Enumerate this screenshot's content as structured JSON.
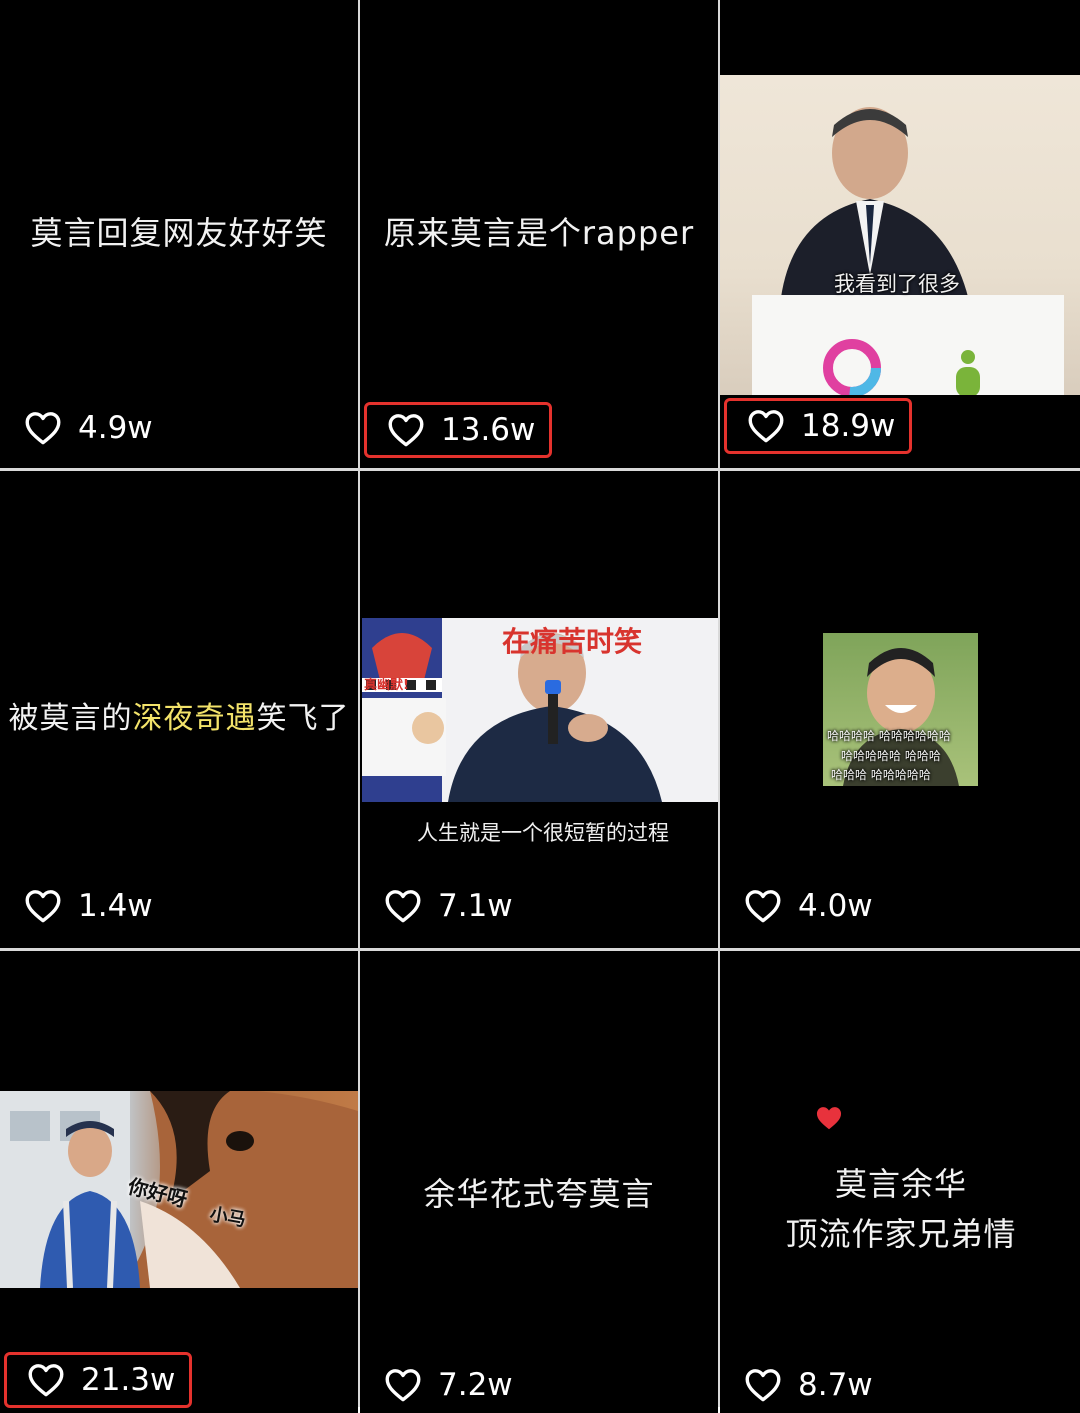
{
  "grid": {
    "videos": [
      {
        "caption": "莫言回复网友好好笑",
        "likes": "4.9w",
        "highlighted": false
      },
      {
        "caption": "原来莫言是个rapper",
        "likes": "13.6w",
        "highlighted": true
      },
      {
        "subtitle": "我看到了很多",
        "likes": "18.9w",
        "highlighted": true
      },
      {
        "caption_parts": [
          "被莫言的",
          "深夜奇遇",
          "笑飞了"
        ],
        "likes": "1.4w",
        "highlighted": false
      },
      {
        "banner": "在痛苦时笑",
        "poster_text": "真幽默!",
        "subtitle": "人生就是一个很短暂的过程",
        "likes": "7.1w",
        "highlighted": false
      },
      {
        "meme_lines": [
          "哈哈哈哈 哈哈哈哈哈哈",
          "哈哈哈哈哈 哈哈哈",
          "哈哈哈 哈哈哈哈哈"
        ],
        "likes": "4.0w",
        "highlighted": false
      },
      {
        "sticker_texts": [
          "你好呀",
          "小马"
        ],
        "likes": "21.3w",
        "highlighted": true
      },
      {
        "caption": "余华花式夸莫言",
        "likes": "7.2w",
        "highlighted": false
      },
      {
        "caption_lines": [
          "莫言余华",
          "顶流作家兄弟情"
        ],
        "likes": "8.7w",
        "highlighted": false
      }
    ]
  },
  "colors": {
    "background": "#000000",
    "highlight_box": "#e5322d",
    "accent_text": "#f3e36a",
    "heart_badge": "#e8323c"
  },
  "icons": {
    "like": "heart-outline-icon",
    "badge": "heart-filled-icon"
  }
}
